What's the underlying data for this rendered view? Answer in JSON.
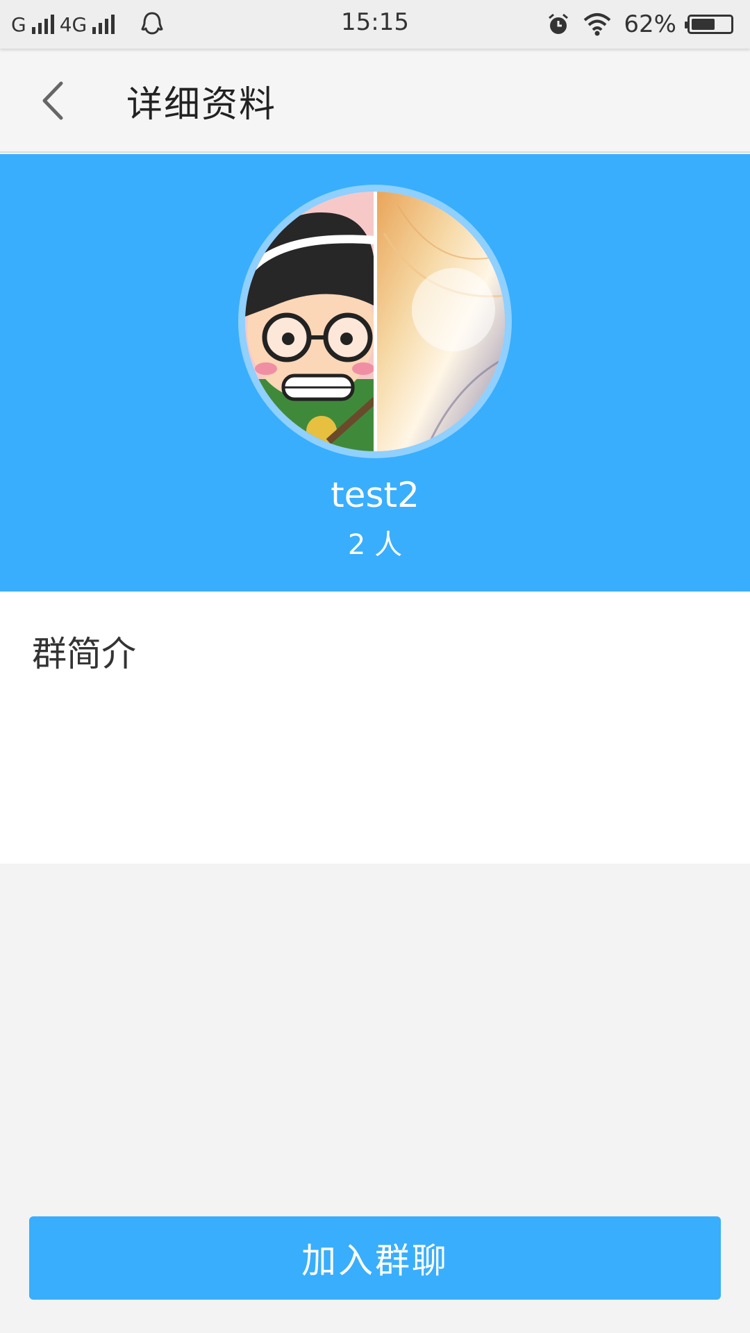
{
  "status_bar": {
    "carrier1": "G",
    "carrier2": "4G",
    "time": "15:15",
    "battery_text": "62%",
    "battery_level": 0.62,
    "icons": [
      "signal-icon",
      "qq-icon",
      "alarm-icon",
      "wifi-icon",
      "battery-icon"
    ]
  },
  "header": {
    "back_icon": "chevron-left-icon",
    "title": "详细资料"
  },
  "profile": {
    "group_name": "test2",
    "member_count": "2 人",
    "background_color": "#39aefc"
  },
  "intro": {
    "title": "群简介",
    "body": ""
  },
  "join_button": {
    "label": "加入群聊",
    "color": "#39aefc"
  }
}
